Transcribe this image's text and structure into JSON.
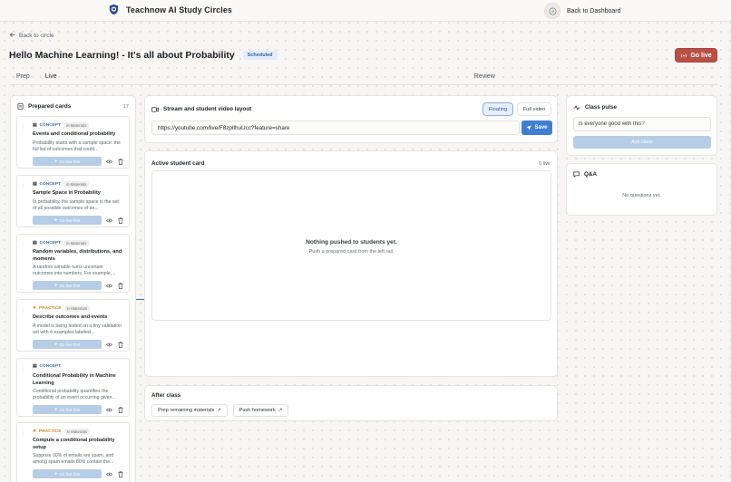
{
  "app": {
    "brand": "Teachnow AI Study Circles",
    "dashboard_link": "Back to Dashboard"
  },
  "nav": {
    "back_label": "Back to circle"
  },
  "header": {
    "title": "Hello Machine Learning! - It's all about Probability",
    "status_badge": "Scheduled",
    "go_live_label": "Go live"
  },
  "tabs": [
    {
      "label": "Prep"
    },
    {
      "label": "Live"
    },
    {
      "label": "Review"
    }
  ],
  "active_tab": "Live",
  "prepared_cards": {
    "title": "Prepared cards",
    "count": "17",
    "go_live_first_label": "Go live first",
    "cards": [
      {
        "kind": "CONCEPT",
        "source": "in Materials",
        "title": "Events and conditional probability",
        "desc": "Probability starts with a sample space: the full list of outcomes that could..."
      },
      {
        "kind": "CONCEPT",
        "source": "in Materials",
        "title": "Sample Space in Probability",
        "desc": "In probability, the sample space is the set of all possible outcomes of an..."
      },
      {
        "kind": "CONCEPT",
        "source": "in Materials",
        "title": "Random variables, distributions, and moments",
        "desc": "A random variable turns uncertain outcomes into numbers. For example,..."
      },
      {
        "kind": "PRACTICE",
        "source": "in Materials",
        "title": "Describe outcomes and events",
        "desc": "A model is being tested on a tiny validation set with 4 examples labeled..."
      },
      {
        "kind": "CONCEPT",
        "source": "",
        "title": "Conditional Probability in Machine Learning",
        "desc": "Conditional probability quantifies the probability of an event occurring given..."
      },
      {
        "kind": "PRACTICE",
        "source": "in Materials",
        "title": "Compute a conditional probability setup",
        "desc": "Suppose 30% of emails are spam, and among spam emails 80% contain the..."
      }
    ]
  },
  "stream": {
    "title": "Stream and student video layout",
    "layout_floating": "Floating",
    "layout_full": "Full video",
    "url_value": "https://youtube.com/live/F8zpIlhuUcc?feature=share",
    "save_label": "Save"
  },
  "active_card": {
    "title": "Active student card",
    "live_count": "0 live",
    "empty_title": "Nothing pushed to students yet.",
    "empty_sub": "Push a prepared card from the left rail."
  },
  "after_class": {
    "title": "After class",
    "prep_remaining": "Prep remaining materials",
    "push_homework": "Push homework"
  },
  "pulse": {
    "title": "Class pulse",
    "question_value": "Is everyone good with this?",
    "ask_label": "Ask class"
  },
  "qa": {
    "title": "Q&A",
    "empty": "No questions yet."
  },
  "colors": {
    "accent": "#3f7fcf",
    "live": "#b85047",
    "concept": "#3f6fb0",
    "practice": "#c98a25",
    "disabled": "#b7cde6"
  }
}
